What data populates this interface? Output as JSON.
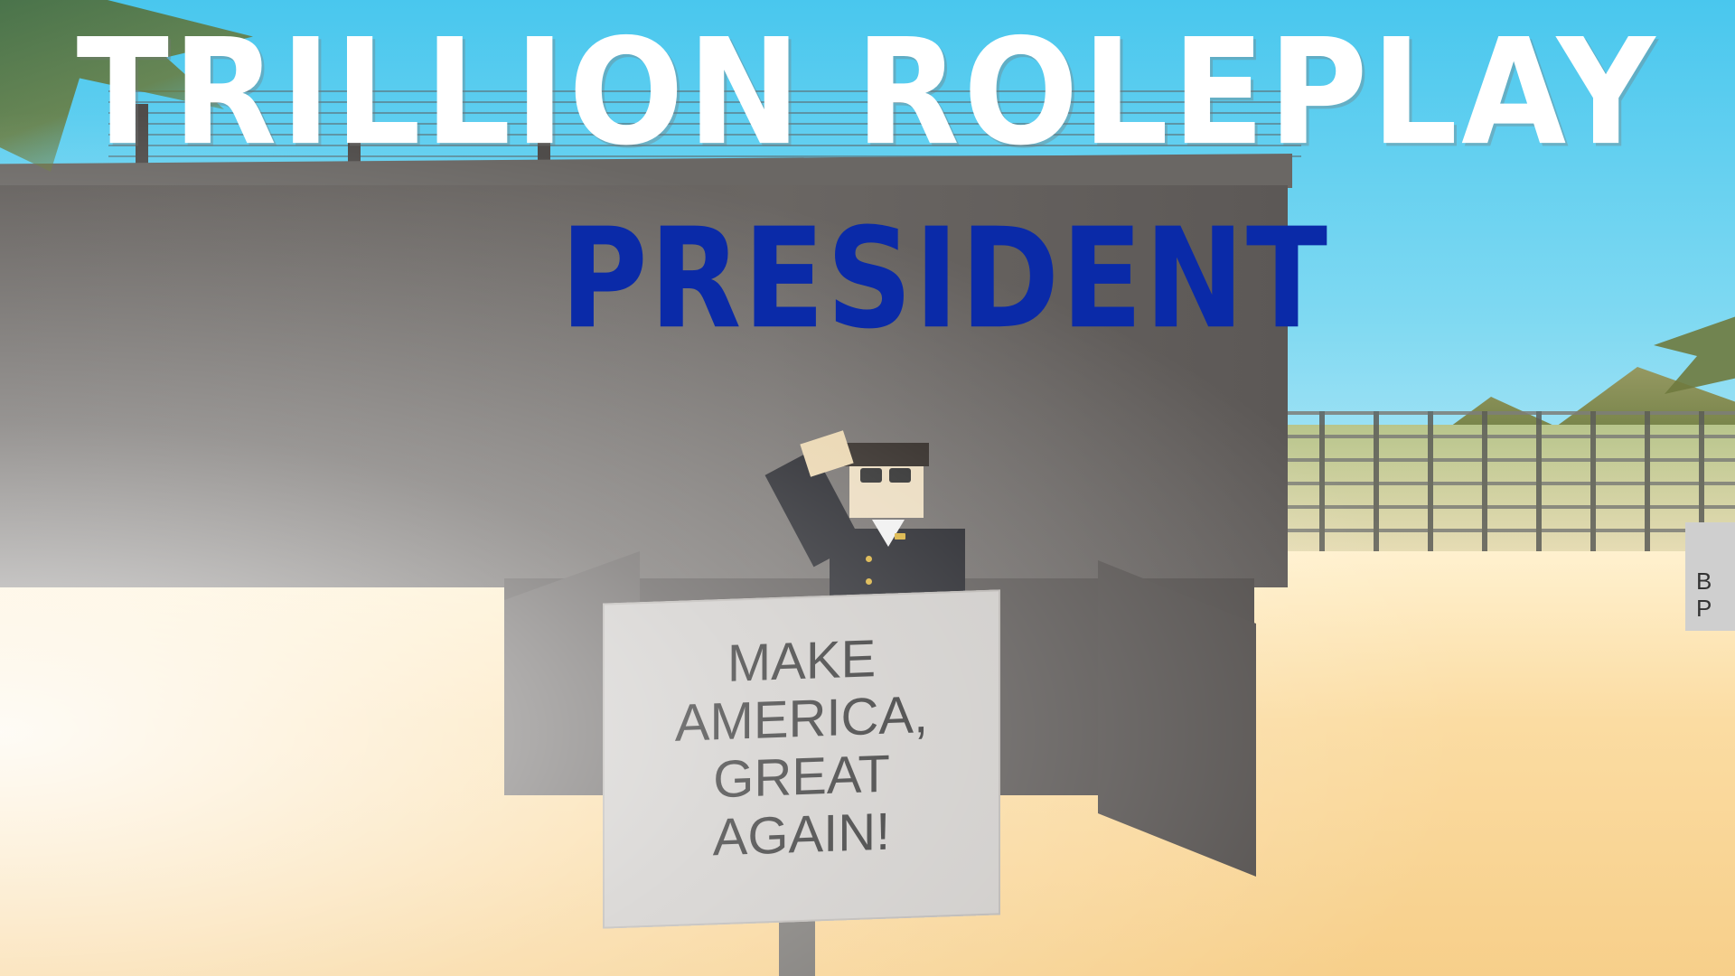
{
  "title": "TRILLION ROLEPLAY",
  "subtitle": "PRESIDENT",
  "sign": {
    "lines": [
      "MAKE",
      "AMERICA,",
      "GREAT",
      "AGAIN!"
    ]
  },
  "side_sign": {
    "line1": "B",
    "line2": "P"
  },
  "colors": {
    "title": "#ffffff",
    "subtitle": "#0a2aa8",
    "wall": "#625e5b",
    "sand": "#fbdca2",
    "sky": "#49c7ee"
  },
  "icons": {
    "character": "suited-character-saluting",
    "sign": "protest-sign"
  }
}
